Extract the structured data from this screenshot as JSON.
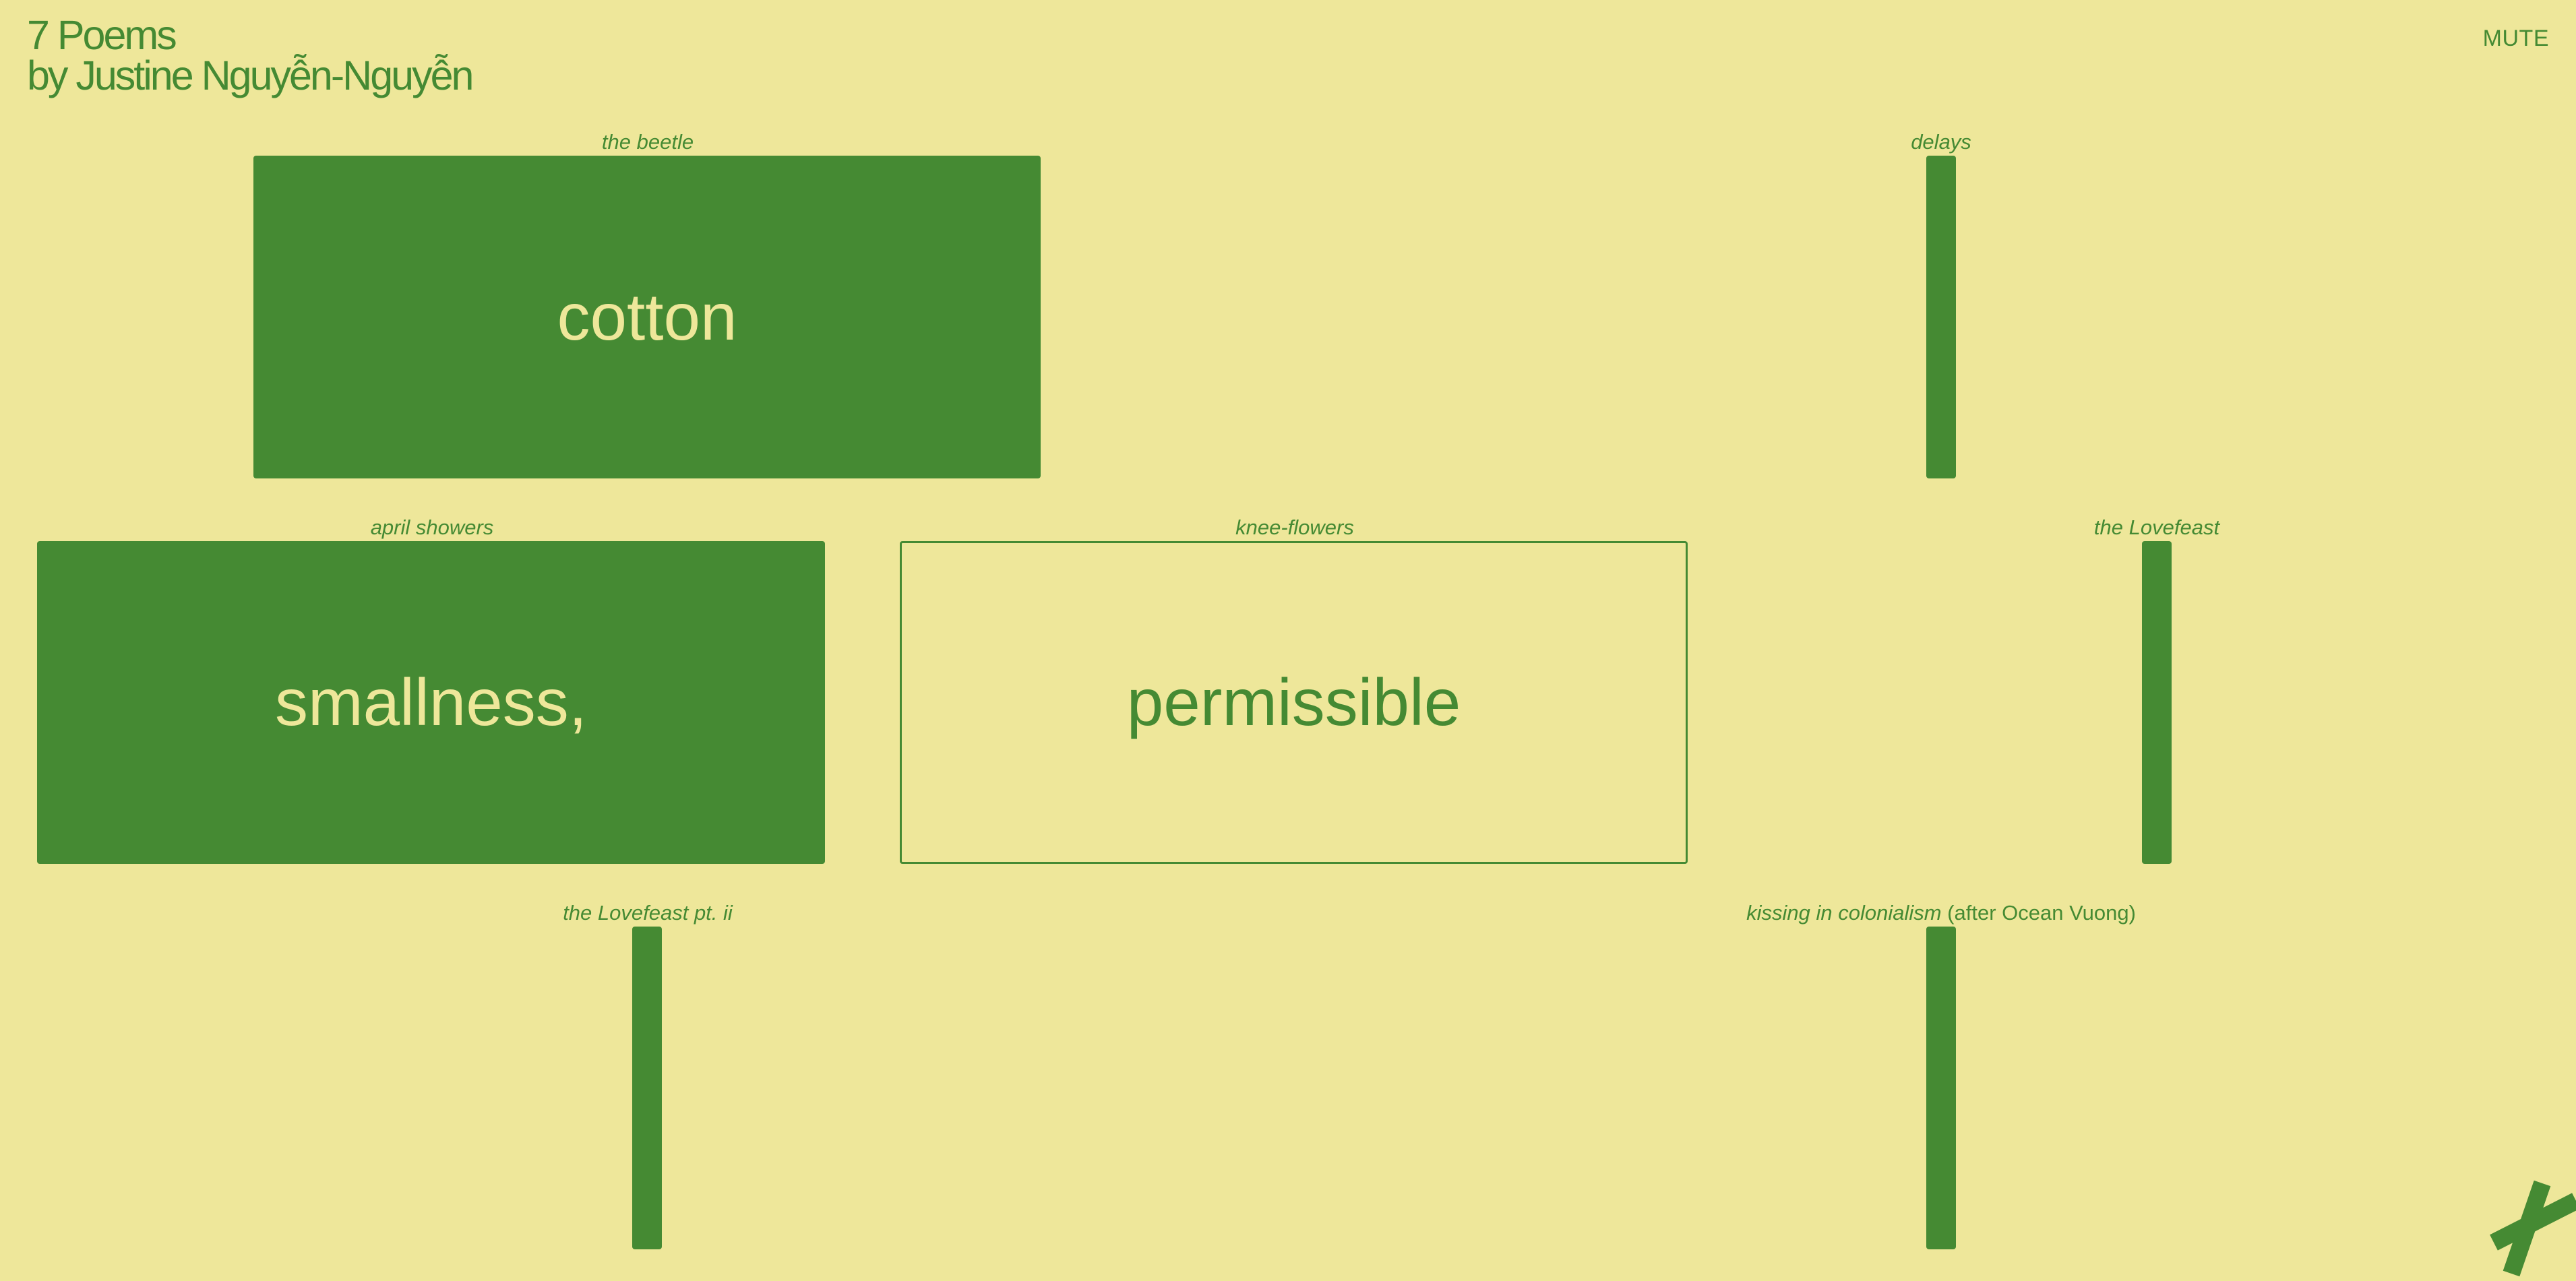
{
  "header": {
    "title_line1": "7 Poems",
    "title_line2": "by Justine Nguyễn-Nguyễn",
    "mute_label": "MUTE"
  },
  "poems": {
    "beetle": {
      "title": "the beetle",
      "word": "cotton",
      "state": "expanded"
    },
    "delays": {
      "title": "delays",
      "word": "",
      "state": "collapsed"
    },
    "april": {
      "title": "april showers",
      "word": "smallness,",
      "state": "expanded"
    },
    "knee": {
      "title": "knee-flowers",
      "word": "permissible",
      "state": "outlined"
    },
    "lovefeast": {
      "title": "the Lovefeast",
      "word": "",
      "state": "collapsed"
    },
    "lovefeast2": {
      "title": "the Lovefeast pt. ii",
      "word": "",
      "state": "collapsed"
    },
    "kissing": {
      "title": "kissing in colonialism",
      "subtitle": "(after Ocean Vuong)",
      "word": "",
      "state": "collapsed"
    }
  },
  "colors": {
    "background": "#eee79a",
    "accent": "#458a33"
  },
  "icons": {
    "corner": "close-x-icon"
  }
}
